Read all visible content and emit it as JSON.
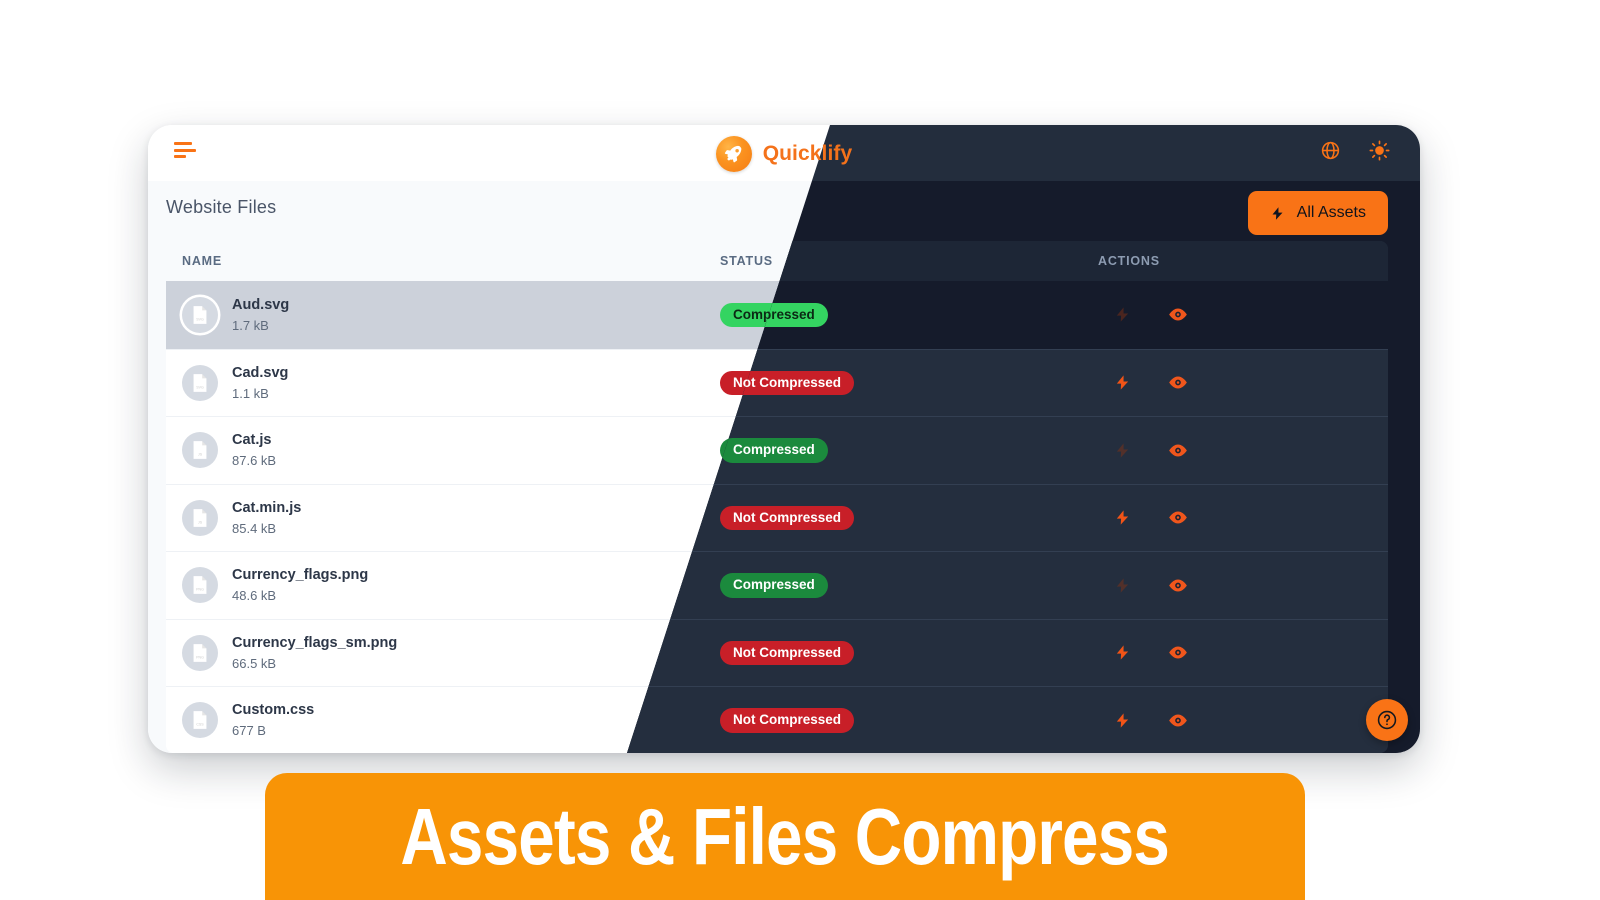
{
  "app": {
    "brand_name": "Quicklify",
    "brand_icon": "rocket-icon",
    "menu_icon": "hamburger-menu-icon",
    "accent_color": "#f97316",
    "topbar_actions": [
      {
        "name": "language-globe-icon",
        "icon": "globe-icon"
      },
      {
        "name": "theme-toggle-icon",
        "icon": "sun-icon"
      }
    ]
  },
  "page": {
    "title": "Website Files",
    "primary_button": {
      "label": "All Assets",
      "icon": "lightning-bolt-icon"
    },
    "help_button": {
      "icon": "question-mark-icon",
      "label": "?"
    }
  },
  "table": {
    "columns": [
      "NAME",
      "STATUS",
      "ACTIONS"
    ],
    "status_labels": {
      "compressed": "Compressed",
      "not_compressed": "Not Compressed"
    },
    "status_colors": {
      "compressed": "#1b8a3d",
      "not_compressed": "#c81f28",
      "compressed_selected": "#34d461"
    },
    "row_actions": [
      {
        "name": "compress-action-icon",
        "icon": "lightning-bolt-icon"
      },
      {
        "name": "preview-action-icon",
        "icon": "eye-icon"
      }
    ],
    "rows": [
      {
        "name": "Aud.svg",
        "size": "1.7 kB",
        "type": "svg",
        "status": "Compressed",
        "compressed": true,
        "selected": true
      },
      {
        "name": "Cad.svg",
        "size": "1.1 kB",
        "type": "svg",
        "status": "Not Compressed",
        "compressed": false,
        "selected": false
      },
      {
        "name": "Cat.js",
        "size": "87.6 kB",
        "type": "js",
        "status": "Compressed",
        "compressed": true,
        "selected": false
      },
      {
        "name": "Cat.min.js",
        "size": "85.4 kB",
        "type": "js",
        "status": "Not Compressed",
        "compressed": false,
        "selected": false
      },
      {
        "name": "Currency_flags.png",
        "size": "48.6 kB",
        "type": "png",
        "status": "Compressed",
        "compressed": true,
        "selected": false
      },
      {
        "name": "Currency_flags_sm.png",
        "size": "66.5 kB",
        "type": "png",
        "status": "Not Compressed",
        "compressed": false,
        "selected": false
      },
      {
        "name": "Custom.css",
        "size": "677 B",
        "type": "css",
        "status": "Not Compressed",
        "compressed": false,
        "selected": false
      }
    ]
  },
  "banner": {
    "text": "Assets & Files Compress",
    "background_color": "#f89406",
    "text_color": "#ffffff"
  }
}
